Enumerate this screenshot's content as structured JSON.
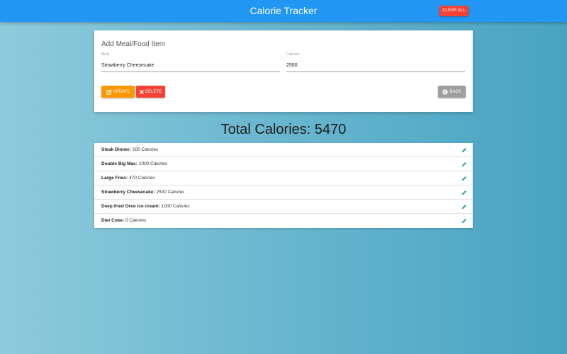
{
  "navbar": {
    "title": "Calorie Tracker",
    "clear_all_label": "CLEAR ALL"
  },
  "form": {
    "title": "Add Meal/Food Item",
    "meal_label": "Meal",
    "meal_value": "Strawberry Cheesecake",
    "calories_label": "Calories",
    "calories_value": "2500",
    "update_label": "UPDATE",
    "delete_label": "DELETE",
    "back_label": "BACK"
  },
  "total": {
    "text": "Total Calories: 5470"
  },
  "items": [
    {
      "name": "Steak Dinner:",
      "calories": "500 Calories"
    },
    {
      "name": "Double Big Mac:",
      "calories": "1000 Calories"
    },
    {
      "name": "Large Fries:",
      "calories": "470 Calories"
    },
    {
      "name": "Strawberry Cheesecake:",
      "calories": "2500 Calories"
    },
    {
      "name": "Deep fried Oreo ice cream:",
      "calories": "1000 Calories"
    },
    {
      "name": "Diet Coke:",
      "calories": "0 Calories"
    }
  ],
  "icons": {
    "update": "edit-icon",
    "delete": "close-icon",
    "back": "chevron-left-circle-icon",
    "item_edit": "pencil-icon"
  },
  "colors": {
    "navbar": "#2196f3",
    "danger": "#f44336",
    "warning": "#ff9800",
    "neutral": "#9e9e9e",
    "edit_icon": "#26a69a"
  }
}
